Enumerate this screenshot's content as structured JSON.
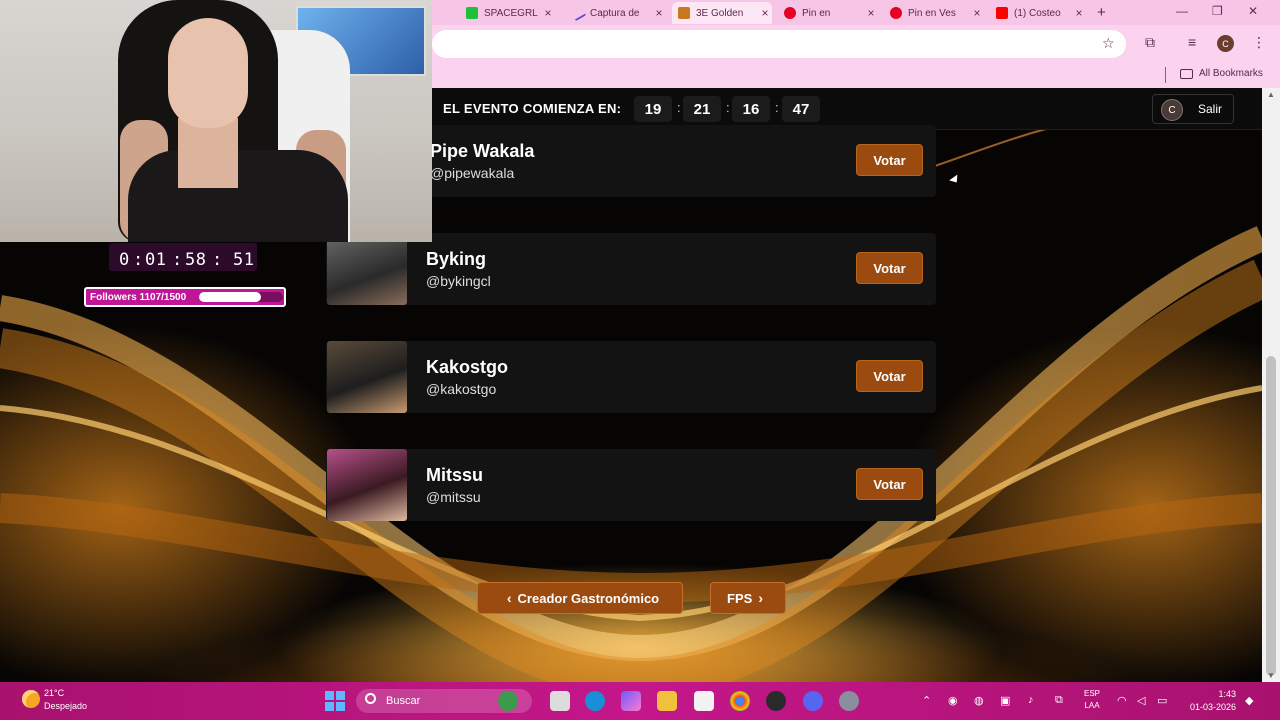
{
  "browser": {
    "tabs": [
      {
        "label": "SPACEGRL",
        "icon": "green-square-icon",
        "color": "#1fbf3a",
        "active": false
      },
      {
        "label": "Captura de",
        "icon": "pen-icon",
        "color": "#5b4bd6",
        "active": false
      },
      {
        "label": "3E Golden",
        "icon": "golden-logo-icon",
        "color": "#c8781e",
        "active": true
      },
      {
        "label": "Pin en",
        "icon": "pinterest-icon",
        "color": "#e60023",
        "active": false
      },
      {
        "label": "Pin en Ves",
        "icon": "pinterest-icon",
        "color": "#e60023",
        "active": false
      },
      {
        "label": "(1) Costeo",
        "icon": "youtube-icon",
        "color": "#ff0000",
        "active": false
      }
    ],
    "bookmarks_label": "All Bookmarks",
    "profile_initial": "C"
  },
  "event": {
    "label": "EL EVENTO COMIENZA EN:",
    "countdown": [
      "19",
      "21",
      "16",
      "47"
    ],
    "user_initial": "C",
    "logout_label": "Salir"
  },
  "candidates": [
    {
      "name": "Pipe Wakala",
      "handle": "@pipewakala",
      "vote_label": "Votar"
    },
    {
      "name": "Byking",
      "handle": "@bykingcl",
      "vote_label": "Votar"
    },
    {
      "name": "Kakostgo",
      "handle": "@kakostgo",
      "vote_label": "Votar"
    },
    {
      "name": "Mitssu",
      "handle": "@mitssu",
      "vote_label": "Votar"
    }
  ],
  "nav": {
    "prev_label": "Creador Gastronómico",
    "next_label": "FPS"
  },
  "overlay": {
    "timer": {
      "values": [
        "0",
        "01",
        "58",
        "51"
      ]
    },
    "followers_label": "Followers 1107/1500",
    "followers_current": 1107,
    "followers_goal": 1500
  },
  "taskbar": {
    "temperature": "21°C",
    "weather": "Despejado",
    "search_label": "Buscar",
    "lang": "ESP",
    "layout": "LAA",
    "time": "1:43",
    "date": "01-03-2026"
  },
  "colors": {
    "accent": "#9c4b10",
    "taskbar": "#c4178a",
    "browser": "#fbd3ee"
  }
}
